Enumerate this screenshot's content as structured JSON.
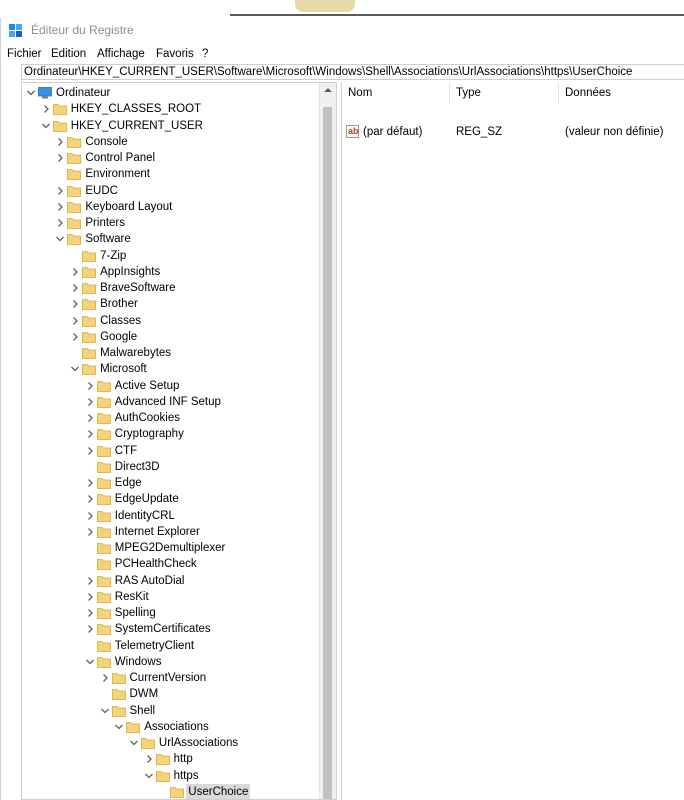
{
  "window": {
    "title": "Éditeur du Registre"
  },
  "menu": [
    "Fichier",
    "Edition",
    "Affichage",
    "Favoris",
    "?"
  ],
  "address": "Ordinateur\\HKEY_CURRENT_USER\\Software\\Microsoft\\Windows\\Shell\\Associations\\UrlAssociations\\https\\UserChoice",
  "tree": [
    {
      "label": "Ordinateur",
      "icon": "computer-icon",
      "chev": "down"
    },
    {
      "label": "HKEY_CLASSES_ROOT",
      "icon": "folder-icon",
      "chev": "right"
    },
    {
      "label": "HKEY_CURRENT_USER",
      "icon": "folder-icon",
      "chev": "down"
    },
    {
      "label": "Console",
      "icon": "folder-icon",
      "chev": "right"
    },
    {
      "label": "Control Panel",
      "icon": "folder-icon",
      "chev": "right"
    },
    {
      "label": "Environment",
      "icon": "folder-icon",
      "chev": "none"
    },
    {
      "label": "EUDC",
      "icon": "folder-icon",
      "chev": "right"
    },
    {
      "label": "Keyboard Layout",
      "icon": "folder-icon",
      "chev": "right"
    },
    {
      "label": "Printers",
      "icon": "folder-icon",
      "chev": "right"
    },
    {
      "label": "Software",
      "icon": "folder-icon",
      "chev": "down"
    },
    {
      "label": "7-Zip",
      "icon": "folder-icon",
      "chev": "none"
    },
    {
      "label": "AppInsights",
      "icon": "folder-icon",
      "chev": "right"
    },
    {
      "label": "BraveSoftware",
      "icon": "folder-icon",
      "chev": "right"
    },
    {
      "label": "Brother",
      "icon": "folder-icon",
      "chev": "right"
    },
    {
      "label": "Classes",
      "icon": "folder-icon",
      "chev": "right"
    },
    {
      "label": "Google",
      "icon": "folder-icon",
      "chev": "right"
    },
    {
      "label": "Malwarebytes",
      "icon": "folder-icon",
      "chev": "none"
    },
    {
      "label": "Microsoft",
      "icon": "folder-icon",
      "chev": "down"
    },
    {
      "label": "Active Setup",
      "icon": "folder-icon",
      "chev": "right"
    },
    {
      "label": "Advanced INF Setup",
      "icon": "folder-icon",
      "chev": "right"
    },
    {
      "label": "AuthCookies",
      "icon": "folder-icon",
      "chev": "right"
    },
    {
      "label": "Cryptography",
      "icon": "folder-icon",
      "chev": "right"
    },
    {
      "label": "CTF",
      "icon": "folder-icon",
      "chev": "right"
    },
    {
      "label": "Direct3D",
      "icon": "folder-icon",
      "chev": "none"
    },
    {
      "label": "Edge",
      "icon": "folder-icon",
      "chev": "right"
    },
    {
      "label": "EdgeUpdate",
      "icon": "folder-icon",
      "chev": "right"
    },
    {
      "label": "IdentityCRL",
      "icon": "folder-icon",
      "chev": "right"
    },
    {
      "label": "Internet Explorer",
      "icon": "folder-icon",
      "chev": "right"
    },
    {
      "label": "MPEG2Demultiplexer",
      "icon": "folder-icon",
      "chev": "none"
    },
    {
      "label": "PCHealthCheck",
      "icon": "folder-icon",
      "chev": "none"
    },
    {
      "label": "RAS AutoDial",
      "icon": "folder-icon",
      "chev": "right"
    },
    {
      "label": "ResKit",
      "icon": "folder-icon",
      "chev": "right"
    },
    {
      "label": "Spelling",
      "icon": "folder-icon",
      "chev": "right"
    },
    {
      "label": "SystemCertificates",
      "icon": "folder-icon",
      "chev": "right"
    },
    {
      "label": "TelemetryClient",
      "icon": "folder-icon",
      "chev": "none"
    },
    {
      "label": "Windows",
      "icon": "folder-icon",
      "chev": "down"
    },
    {
      "label": "CurrentVersion",
      "icon": "folder-icon",
      "chev": "right"
    },
    {
      "label": "DWM",
      "icon": "folder-icon",
      "chev": "none"
    },
    {
      "label": "Shell",
      "icon": "folder-icon",
      "chev": "down"
    },
    {
      "label": "Associations",
      "icon": "folder-icon",
      "chev": "down"
    },
    {
      "label": "UrlAssociations",
      "icon": "folder-icon",
      "chev": "down"
    },
    {
      "label": "http",
      "icon": "folder-icon",
      "chev": "right"
    },
    {
      "label": "https",
      "icon": "folder-icon",
      "chev": "down"
    },
    {
      "label": "UserChoice",
      "icon": "folder-icon",
      "chev": "none",
      "selected": true
    }
  ],
  "columns": {
    "name": "Nom",
    "type": "Type",
    "data": "Données"
  },
  "values": [
    {
      "name": "(par défaut)",
      "type": "REG_SZ",
      "data": "(valeur non définie)",
      "icon": "string-value-icon"
    }
  ],
  "colors": {
    "folder": "#f5d37a",
    "folder_edge": "#d9a92e",
    "selection": "#d9d9d9",
    "chevron": "#606060"
  }
}
